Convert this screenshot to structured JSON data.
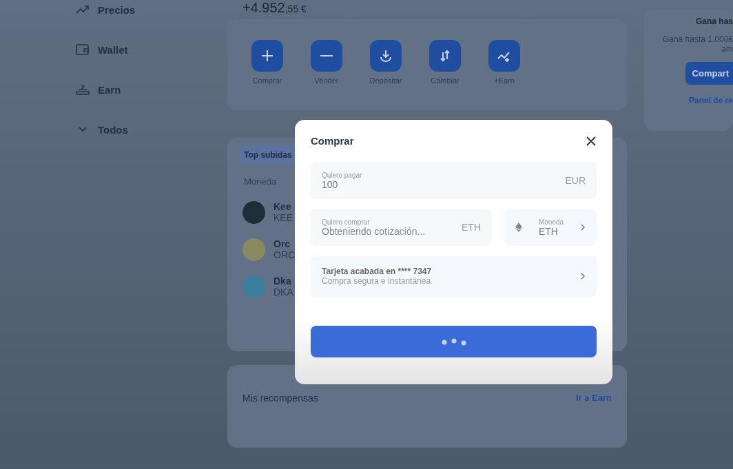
{
  "sidebar": {
    "items": [
      {
        "label": "Precios"
      },
      {
        "label": "Wallet"
      },
      {
        "label": "Earn"
      },
      {
        "label": "Todos"
      }
    ]
  },
  "balance": {
    "whole": "+4.952",
    "cents": ",55 €"
  },
  "actions": [
    {
      "label": "Comprar"
    },
    {
      "label": "Vender"
    },
    {
      "label": "Depositar"
    },
    {
      "label": "Cambiar"
    },
    {
      "label": "+Earn"
    }
  ],
  "top_tab": "Top subidas",
  "column_1": "Moneda",
  "coins": [
    {
      "name": "Kee",
      "symbol": "KEE",
      "color": "#1f2d3a"
    },
    {
      "name": "Orc",
      "symbol": "ORC",
      "color": "#8a8a62"
    },
    {
      "name": "Dka",
      "symbol": "DKA",
      "color": "#3a7f9c"
    }
  ],
  "rewards": {
    "title": "Mis recompensas",
    "link": "Ir a Earn"
  },
  "promo": {
    "title": "Gana has",
    "text_1": "Gana hasta 1.000€",
    "text_2": "am",
    "button": "Compart",
    "link": "Panel de re"
  },
  "modal": {
    "title": "Comprar",
    "pay": {
      "label": "Quiero pagar",
      "value": "100",
      "currency": "EUR"
    },
    "buy": {
      "label": "Quiero comprar",
      "placeholder": "Obteniendo cotización...",
      "currency": "ETH"
    },
    "coin": {
      "label": "Moneda",
      "value": "ETH"
    },
    "card": {
      "title": "Tarjeta acabada en **** 7347",
      "subtitle": "Compra segura e instantánea"
    },
    "loading": true
  }
}
